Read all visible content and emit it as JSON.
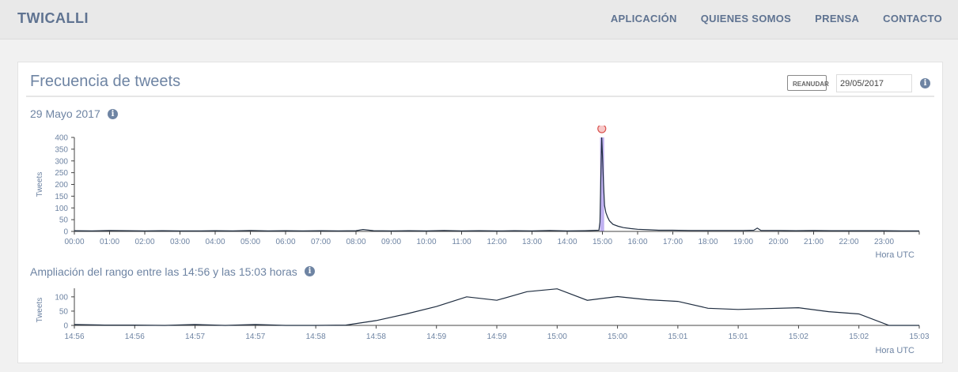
{
  "header": {
    "brand": "TWICALLI",
    "nav": [
      "APLICACIÓN",
      "QUIENES SOMOS",
      "PRENSA",
      "CONTACTO"
    ]
  },
  "panel": {
    "title": "Frecuencia de tweets",
    "resume_label": "REANUDAR",
    "date_value": "29/05/2017"
  },
  "chart_data": [
    {
      "type": "line",
      "subtitle": "29 Mayo 2017",
      "ylabel": "Tweets",
      "xlabel": "Hora UTC",
      "ylim": [
        0,
        400
      ],
      "yticks": [
        0,
        50,
        100,
        150,
        200,
        250,
        300,
        350,
        400
      ],
      "xlim_hours": [
        0,
        24
      ],
      "xtick_labels": [
        "00:00",
        "01:00",
        "02:00",
        "03:00",
        "04:00",
        "05:00",
        "06:00",
        "07:00",
        "08:00",
        "09:00",
        "10:00",
        "11:00",
        "12:00",
        "13:00",
        "14:00",
        "15:00",
        "16:00",
        "17:00",
        "18:00",
        "19:00",
        "20:00",
        "21:00",
        "22:00",
        "23:00"
      ],
      "highlight_range": [
        "14:56",
        "15:03"
      ],
      "peak": {
        "time": "14:59",
        "value": 400
      },
      "series": [
        {
          "x_hours": [
            0,
            0.5,
            1,
            1.5,
            2,
            2.5,
            3,
            3.5,
            4,
            4.5,
            5,
            5.5,
            6,
            6.5,
            7,
            7.5,
            8,
            8.2,
            8.5,
            9,
            9.5,
            10,
            10.5,
            11,
            11.5,
            12,
            12.5,
            13,
            13.5,
            14,
            14.5,
            14.9,
            14.93,
            14.96,
            14.98,
            15.0,
            15.03,
            15.06,
            15.1,
            15.15,
            15.2,
            15.3,
            15.45,
            15.6,
            15.8,
            16,
            16.3,
            16.6,
            17,
            17.5,
            18,
            18.5,
            19,
            19.3,
            19.4,
            19.5,
            20,
            20.5,
            21,
            21.5,
            22,
            22.5,
            23,
            23.5,
            24
          ],
          "values": [
            3,
            2,
            4,
            3,
            2,
            3,
            2,
            2,
            3,
            2,
            4,
            2,
            3,
            2,
            3,
            2,
            3,
            8,
            3,
            2,
            3,
            2,
            4,
            2,
            3,
            2,
            3,
            2,
            4,
            2,
            3,
            5,
            40,
            260,
            400,
            330,
            210,
            110,
            80,
            60,
            45,
            30,
            22,
            16,
            12,
            9,
            7,
            5,
            5,
            4,
            4,
            4,
            4,
            5,
            14,
            4,
            4,
            3,
            4,
            3,
            3,
            3,
            3,
            2,
            2
          ]
        }
      ]
    },
    {
      "type": "line",
      "subtitle": "Ampliación del rango entre las 14:56 y las 15:03 horas",
      "ylabel": "Tweets",
      "xlabel": "Hora UTC",
      "ylim": [
        0,
        130
      ],
      "yticks": [
        0,
        50,
        100
      ],
      "xtick_labels": [
        "14:56",
        "14:56",
        "14:57",
        "14:57",
        "14:58",
        "14:58",
        "14:59",
        "14:59",
        "15:00",
        "15:00",
        "15:01",
        "15:01",
        "15:02",
        "15:02",
        "15:03"
      ],
      "series": [
        {
          "x_index": [
            0,
            0.5,
            1,
            1.5,
            2,
            2.5,
            3,
            3.5,
            4,
            4.5,
            5,
            5.5,
            6,
            6.5,
            7,
            7.5,
            8,
            8.5,
            9,
            9.5,
            10,
            10.5,
            11,
            11.5,
            12,
            12.5,
            13,
            13.5,
            14
          ],
          "values": [
            3,
            1,
            1,
            0,
            3,
            0,
            3,
            0,
            0,
            1,
            17,
            40,
            66,
            100,
            88,
            118,
            128,
            88,
            101,
            90,
            84,
            60,
            56,
            59,
            62,
            48,
            40,
            0,
            0
          ]
        }
      ]
    }
  ]
}
